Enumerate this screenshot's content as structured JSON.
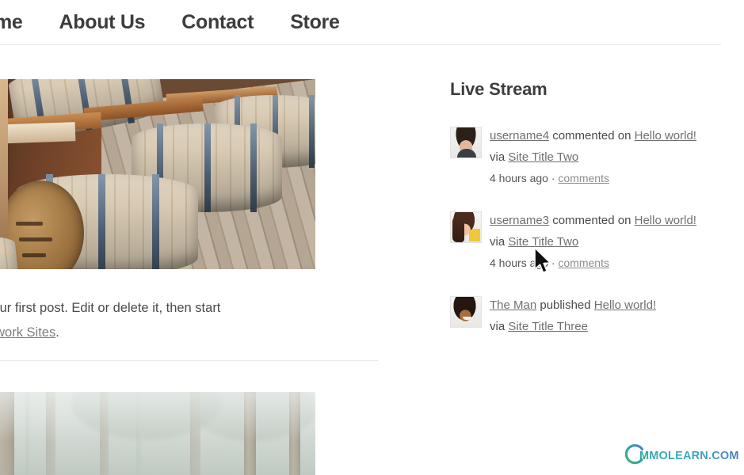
{
  "header": {
    "nav_items": [
      {
        "label": "ome",
        "name": "nav-home"
      },
      {
        "label": "About Us",
        "name": "nav-about-us"
      },
      {
        "label": "Contact",
        "name": "nav-contact"
      },
      {
        "label": "Store",
        "name": "nav-store"
      }
    ]
  },
  "main": {
    "post": {
      "image_alt": "wooden whiskey barrels lined up on a wooden floor",
      "excerpt_line1_prefix": "his is your first post. Edit or delete it, then start",
      "excerpt_line2_link": "her Network Sites",
      "excerpt_line2_suffix": "."
    },
    "post2": {
      "image_alt": "misty pine forest"
    }
  },
  "sidebar": {
    "title": "Live Stream",
    "items": [
      {
        "avatar_alt": "avatar of username4",
        "actor": "username4",
        "verb": " commented on ",
        "object": "Hello world!",
        "via": " via ",
        "site": "Site Title Two",
        "time": "4 hours ago",
        "separator": " · ",
        "comments_label": "comments"
      },
      {
        "avatar_alt": "avatar of username3",
        "actor": "username3",
        "verb": " commented on ",
        "object": "Hello world!",
        "via": " via ",
        "site": "Site Title Two",
        "time": "4 hours ago",
        "separator": " · ",
        "comments_label": "comments"
      },
      {
        "avatar_alt": "avatar of The Man",
        "actor": "The Man",
        "verb": " published ",
        "object": "Hello world!",
        "via": "via ",
        "site": "Site Title Three",
        "time": "",
        "separator": "",
        "comments_label": ""
      }
    ]
  },
  "watermark": {
    "text": "MMOLEARN.COM",
    "logo_colors": [
      "#2aa8a0",
      "#3fa9c6",
      "#4a7fc1"
    ]
  },
  "colors": {
    "text": "#3a3a3a",
    "link": "#6f6f6f",
    "rule": "#e8e8e8",
    "background": "#ffffff"
  }
}
